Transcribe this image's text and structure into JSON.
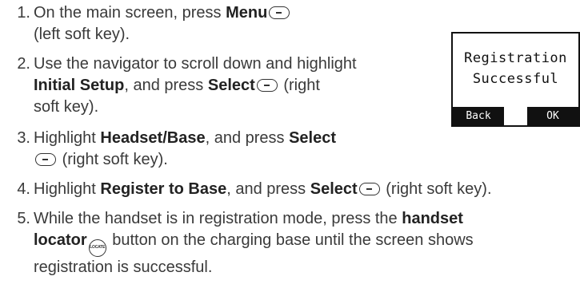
{
  "steps": [
    {
      "num": "1.",
      "parts": [
        {
          "t": "On the main screen, press "
        },
        {
          "b": "Menu"
        },
        {
          "key": "softkey-icon"
        },
        {
          "br": true
        },
        {
          "t": "(left soft key)."
        }
      ]
    },
    {
      "num": "2.",
      "parts": [
        {
          "t": "Use the navigator to scroll down and highlight"
        },
        {
          "br": true
        },
        {
          "b": "Initial Setup"
        },
        {
          "t": ", and press "
        },
        {
          "b": "Select"
        },
        {
          "key": "softkey-icon"
        },
        {
          "t": "(right"
        },
        {
          "br": true
        },
        {
          "t": "soft key)."
        }
      ]
    },
    {
      "num": "3.",
      "parts": [
        {
          "t": "Highlight "
        },
        {
          "b": "Headset/Base"
        },
        {
          "t": ", and press "
        },
        {
          "b": "Select"
        },
        {
          "br": true
        },
        {
          "key": "softkey-icon"
        },
        {
          "t": "(right soft key)."
        }
      ]
    },
    {
      "num": "4.",
      "parts": [
        {
          "t": "Highlight "
        },
        {
          "b": "Register to Base"
        },
        {
          "t": ", and press "
        },
        {
          "b": "Select"
        },
        {
          "key": "softkey-icon"
        },
        {
          "t": "(right soft key)."
        }
      ]
    },
    {
      "num": "5.",
      "parts": [
        {
          "t": "While the handset is in registration mode, press the "
        },
        {
          "b": "handset"
        },
        {
          "br": true
        },
        {
          "b": "locator"
        },
        {
          "key": "locator-icon",
          "label": "LOCATE"
        },
        {
          "t": "button on the charging base until the screen shows"
        },
        {
          "br": true
        },
        {
          "t": "registration is successful."
        }
      ]
    }
  ],
  "screen": {
    "message_line1": "Registration",
    "message_line2": "Successful",
    "left_softkey": "Back",
    "right_softkey": "OK"
  }
}
